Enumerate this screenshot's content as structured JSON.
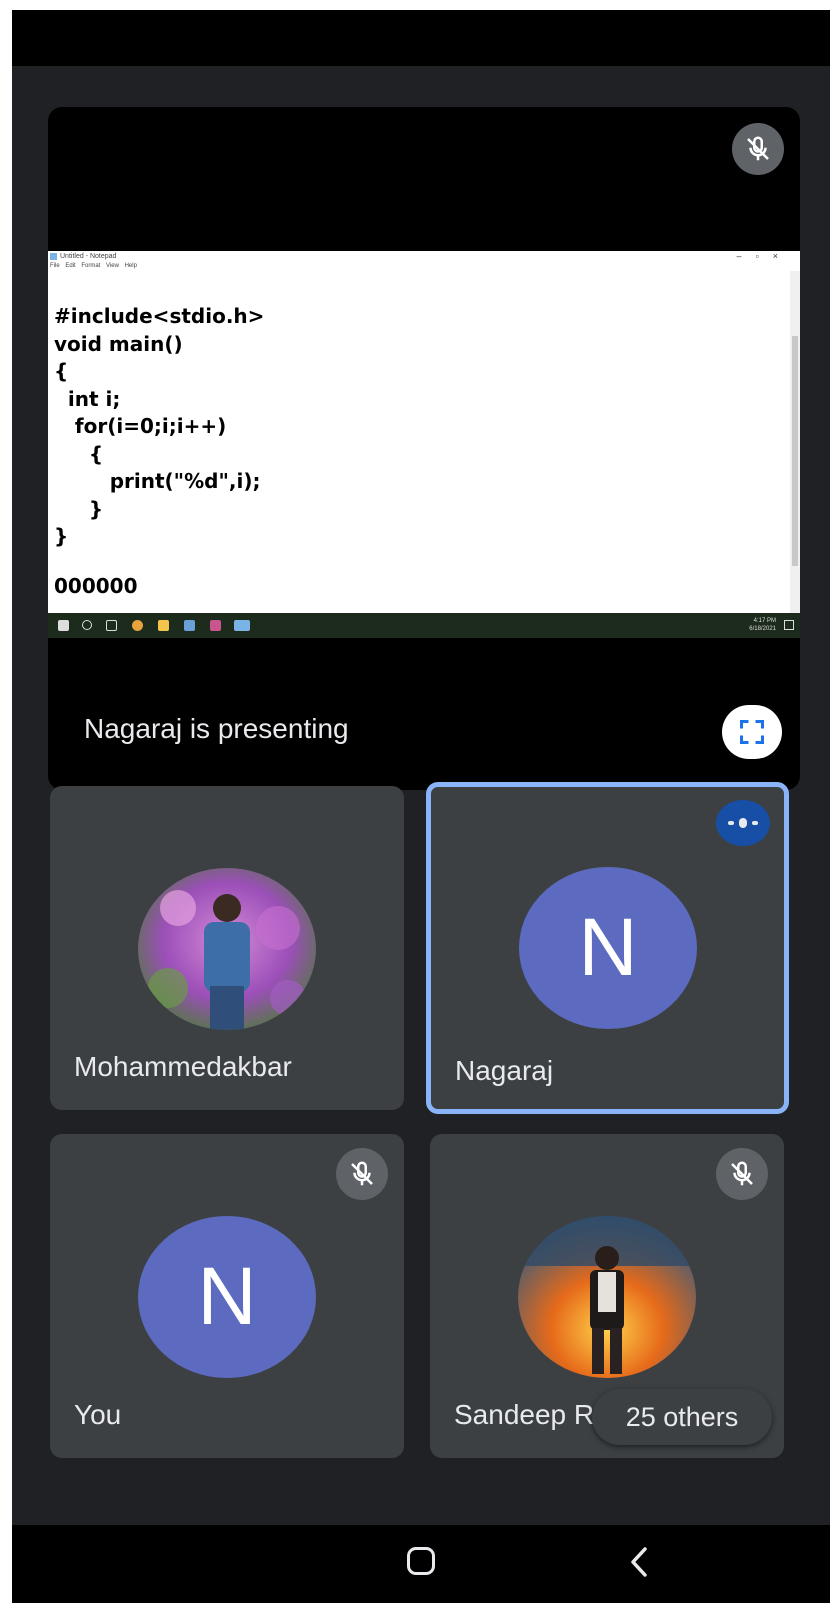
{
  "presentation": {
    "presenting_label": "Nagaraj is presenting",
    "shared_window": {
      "title": "Untitled - Notepad",
      "menu": "File  Edit  Format  View  Help",
      "code": "#include<stdio.h>\nvoid main()\n{\n  int i;\n   for(i=0;i;i++)\n     {\n        print(\"%d\",i);\n     }\n}",
      "output": "000000",
      "tray_time": "4:17 PM",
      "tray_date": "6/18/2021"
    },
    "icons": {
      "mic": "mic-off-icon",
      "fullscreen": "fullscreen-icon"
    }
  },
  "participants": [
    {
      "name": "Mohammedakbar",
      "avatar": "photo",
      "muted": false
    },
    {
      "name": "Nagaraj",
      "avatar_letter": "N",
      "speaking": true,
      "active": true
    },
    {
      "name": "You",
      "avatar_letter": "N",
      "muted": true
    },
    {
      "name": "Sandeep R",
      "avatar": "photo",
      "muted": true
    }
  ],
  "others_count_label": "25 others",
  "colors": {
    "background": "#202124",
    "tile": "#3c4043",
    "avatar": "#5c6bc0",
    "active_border": "#8ab4f8",
    "speaking_badge": "#174ea6"
  }
}
